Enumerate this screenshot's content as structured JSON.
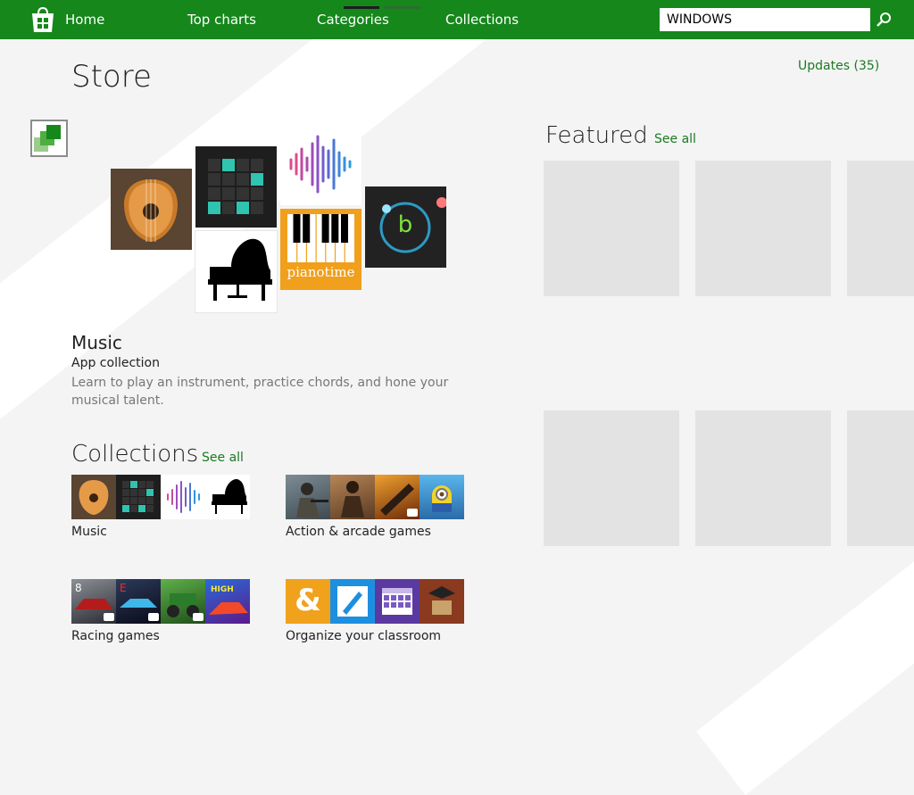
{
  "nav": {
    "home": "Home",
    "top_charts": "Top charts",
    "categories": "Categories",
    "collections": "Collections",
    "search_value": "WINDOWS"
  },
  "header": {
    "title": "Store",
    "updates": "Updates (35)"
  },
  "hero": {
    "title": "Music",
    "subtitle": "App collection",
    "description": "Learn to play an instrument, practice chords, and hone your musical talent.",
    "pianotime_label": "pianotime",
    "b_label": "b"
  },
  "featured": {
    "title": "Featured",
    "see_all": "See all"
  },
  "collections": {
    "title": "Collections",
    "see_all": "See all",
    "items": [
      {
        "label": "Music"
      },
      {
        "label": "Action & arcade games"
      },
      {
        "label": "Racing games"
      },
      {
        "label": "Organize your classroom"
      }
    ]
  },
  "colors": {
    "accent": "#15871b",
    "link": "#1c7a22"
  }
}
